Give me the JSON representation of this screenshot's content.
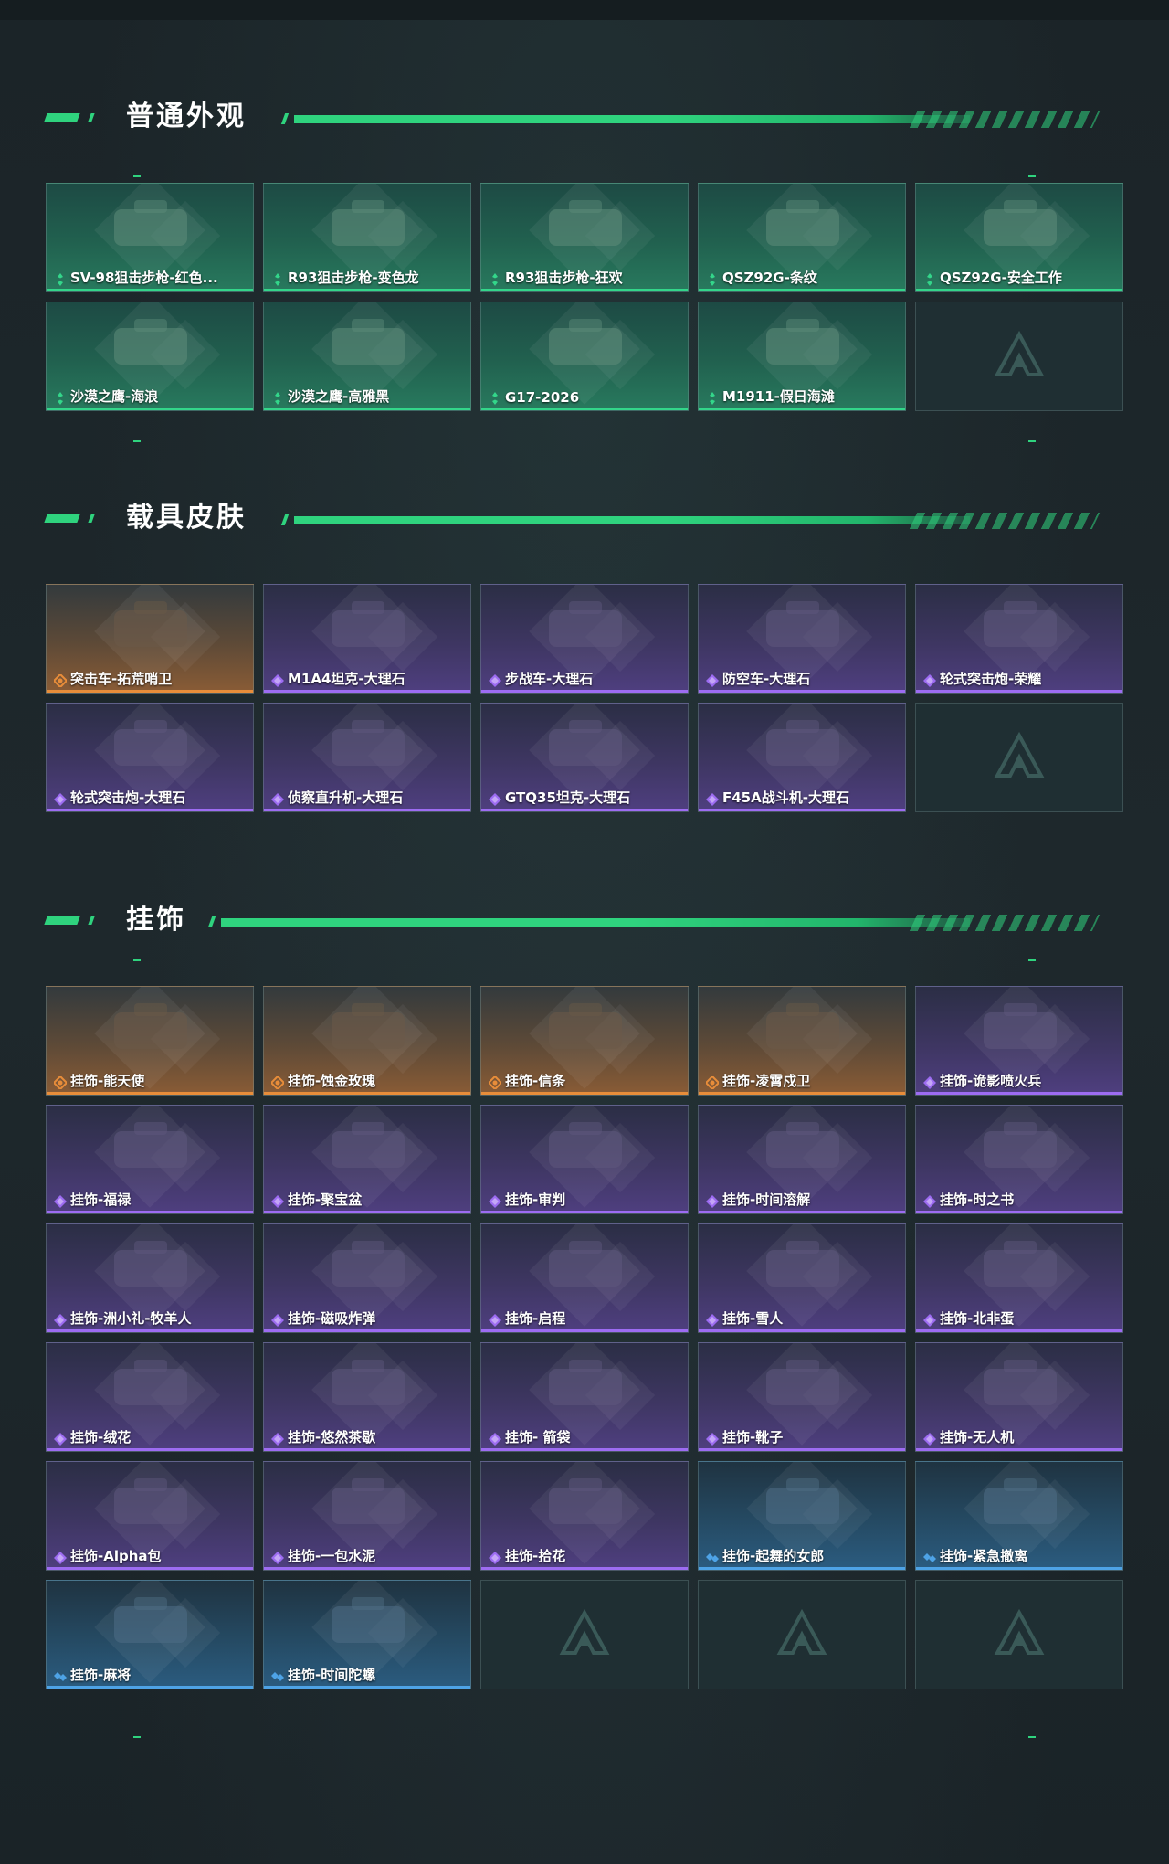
{
  "sections": {
    "normal": {
      "title": "普通外观",
      "items": [
        {
          "label": "SV-98狙击步枪-红色...",
          "rarity": "green",
          "icon": "sniper-rifle-red"
        },
        {
          "label": "R93狙击步枪-变色龙",
          "rarity": "green",
          "icon": "sniper-rifle-camo"
        },
        {
          "label": "R93狙击步枪-狂欢",
          "rarity": "green",
          "icon": "sniper-rifle"
        },
        {
          "label": "QSZ92G-条纹",
          "rarity": "green",
          "icon": "pistol-green"
        },
        {
          "label": "QSZ92G-安全工作",
          "rarity": "green",
          "icon": "pistol"
        },
        {
          "label": "沙漠之鹰-海浪",
          "rarity": "green",
          "icon": "desert-eagle-blue"
        },
        {
          "label": "沙漠之鹰-高雅黑",
          "rarity": "green",
          "icon": "desert-eagle-black"
        },
        {
          "label": "G17-2026",
          "rarity": "green",
          "icon": "pistol-blue"
        },
        {
          "label": "M1911-假日海滩",
          "rarity": "green",
          "icon": "pistol"
        }
      ]
    },
    "vehicle": {
      "title": "载具皮肤",
      "items": [
        {
          "label": "突击车-拓荒哨卫",
          "rarity": "orange",
          "icon": "assault-vehicle"
        },
        {
          "label": "M1A4坦克-大理石",
          "rarity": "purple",
          "icon": "tank"
        },
        {
          "label": "步战车-大理石",
          "rarity": "purple",
          "icon": "ifv"
        },
        {
          "label": "防空车-大理石",
          "rarity": "purple",
          "icon": "aa-vehicle"
        },
        {
          "label": "轮式突击炮-荣耀",
          "rarity": "purple",
          "icon": "wheeled-gun"
        },
        {
          "label": "轮式突击炮-大理石",
          "rarity": "purple",
          "icon": "wheeled-gun"
        },
        {
          "label": "侦察直升机-大理石",
          "rarity": "purple",
          "icon": "helicopter"
        },
        {
          "label": "GTQ35坦克-大理石",
          "rarity": "purple",
          "icon": "tank"
        },
        {
          "label": "F45A战斗机-大理石",
          "rarity": "purple",
          "icon": "fighter-jet"
        }
      ]
    },
    "charm": {
      "title": "挂饰",
      "items": [
        {
          "label": "挂饰-能天使",
          "rarity": "orange"
        },
        {
          "label": "挂饰-蚀金玫瑰",
          "rarity": "orange"
        },
        {
          "label": "挂饰-信条",
          "rarity": "orange"
        },
        {
          "label": "挂饰-凌霄戍卫",
          "rarity": "orange"
        },
        {
          "label": "挂饰-诡影喷火兵",
          "rarity": "purple"
        },
        {
          "label": "挂饰-福禄",
          "rarity": "purple"
        },
        {
          "label": "挂饰-聚宝盆",
          "rarity": "purple"
        },
        {
          "label": "挂饰-审判",
          "rarity": "purple"
        },
        {
          "label": "挂饰-时间溶解",
          "rarity": "purple"
        },
        {
          "label": "挂饰-时之书",
          "rarity": "purple"
        },
        {
          "label": "挂饰-洲小礼-牧羊人",
          "rarity": "purple"
        },
        {
          "label": "挂饰-磁吸炸弹",
          "rarity": "purple"
        },
        {
          "label": "挂饰-启程",
          "rarity": "purple"
        },
        {
          "label": "挂饰-雪人",
          "rarity": "purple"
        },
        {
          "label": "挂饰-北非蛋",
          "rarity": "purple"
        },
        {
          "label": "挂饰-绒花",
          "rarity": "purple"
        },
        {
          "label": "挂饰-悠然茶歇",
          "rarity": "purple"
        },
        {
          "label": "挂饰- 箭袋",
          "rarity": "purple"
        },
        {
          "label": "挂饰-靴子",
          "rarity": "purple"
        },
        {
          "label": "挂饰-无人机",
          "rarity": "purple"
        },
        {
          "label": "挂饰-Alpha包",
          "rarity": "purple"
        },
        {
          "label": "挂饰-一包水泥",
          "rarity": "purple"
        },
        {
          "label": "挂饰-拾花",
          "rarity": "purple"
        },
        {
          "label": "挂饰-起舞的女郎",
          "rarity": "blue"
        },
        {
          "label": "挂饰-紧急撤离",
          "rarity": "blue"
        },
        {
          "label": "挂饰-麻将",
          "rarity": "blue"
        },
        {
          "label": "挂饰-时间陀螺",
          "rarity": "blue"
        }
      ]
    }
  },
  "colors": {
    "accent": "#2fd37e",
    "green": "#33d68a",
    "orange": "#e88d3a",
    "purple": "#9d6cf2",
    "blue": "#4ea3e6"
  },
  "grid_config": {
    "normal_empty_slots": 1,
    "vehicle_empty_slots": 1,
    "charm_empty_slots": 3
  }
}
